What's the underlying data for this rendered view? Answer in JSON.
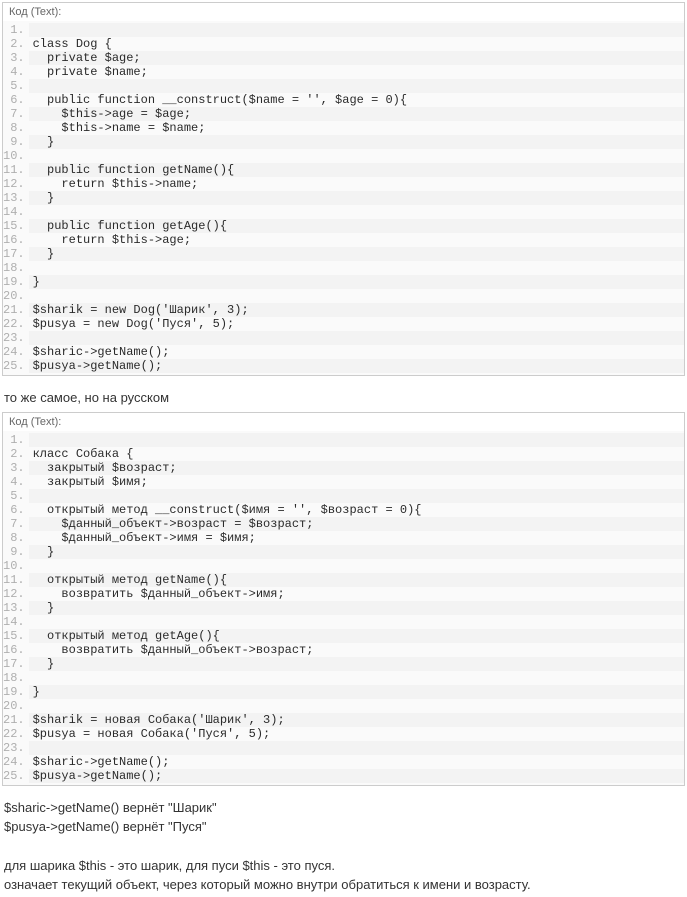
{
  "block1": {
    "header": "Код (Text):",
    "lines": [
      "",
      "class Dog {",
      "  private $age;",
      "  private $name;",
      "",
      "  public function __construct($name = '', $age = 0){",
      "    $this->age = $age;",
      "    $this->name = $name;",
      "  }",
      "",
      "  public function getName(){",
      "    return $this->name;",
      "  }",
      "",
      "  public function getAge(){",
      "    return $this->age;",
      "  }",
      "",
      "}",
      "",
      "$sharik = new Dog('Шарик', 3);",
      "$pusya = new Dog('Пуся', 5);",
      "",
      "$sharic->getName();",
      "$pusya->getName();"
    ]
  },
  "text1": "то же самое, но на русском",
  "block2": {
    "header": "Код (Text):",
    "lines": [
      "",
      "класс Собака {",
      "  закрытый $возраст;",
      "  закрытый $имя;",
      "",
      "  открытый метод __construct($имя = '', $возраст = 0){",
      "    $данный_объект->возраст = $возраст;",
      "    $данный_объект->имя = $имя;",
      "  }",
      "",
      "  открытый метод getName(){",
      "    возвратить $данный_объект->имя;",
      "  }",
      "",
      "  открытый метод getAge(){",
      "    возвратить $данный_объект->возраст;",
      "  }",
      "",
      "}",
      "",
      "$sharik = новая Собака('Шарик', 3);",
      "$pusya = новая Собака('Пуся', 5);",
      "",
      "$sharic->getName();",
      "$pusya->getName();"
    ]
  },
  "text2_line1": "$sharic->getName() вернёт \"Шарик\"",
  "text2_line2": "$pusya->getName() вернёт \"Пуся\"",
  "text3_line1": "для шарика $this - это шарик, для пуси $this - это пуся.",
  "text3_line2": "означает текущий объект, через который можно внутри обратиться к имени и возрасту."
}
